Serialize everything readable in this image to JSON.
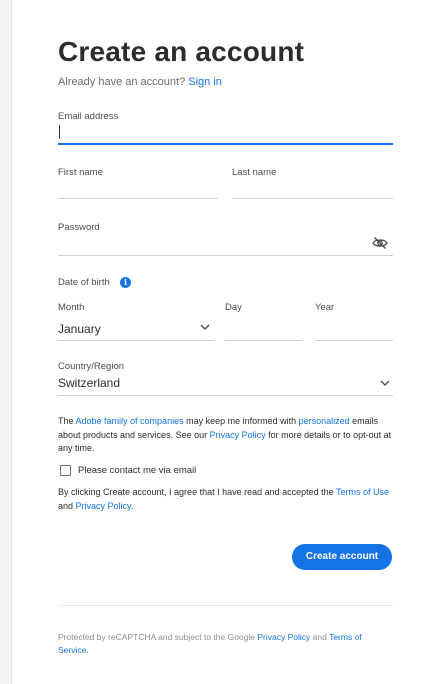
{
  "header": {
    "title": "Create an account",
    "signin_prompt": "Already have an account?",
    "signin_link": "Sign in"
  },
  "fields": {
    "email_label": "Email address",
    "email_value": "",
    "first_name_label": "First name",
    "first_name_value": "",
    "last_name_label": "Last name",
    "last_name_value": "",
    "password_label": "Password",
    "password_value": "",
    "password_toggle_icon": "eye-slash-icon"
  },
  "dob": {
    "label": "Date of birth",
    "info_icon": "info-icon",
    "month_label": "Month",
    "month_value": "January",
    "day_label": "Day",
    "day_value": "",
    "year_label": "Year",
    "year_value": ""
  },
  "country": {
    "label": "Country/Region",
    "value": "Switzerland"
  },
  "consent": {
    "text_1": "The ",
    "link_family": "Adobe family of companies",
    "text_2": " may keep me informed with ",
    "link_personalized": "personalized",
    "text_3": " emails about products and services. See our ",
    "link_privacy": "Privacy Policy",
    "text_4": " for more details or to opt-out at any time.",
    "checkbox_label": "Please contact me via email",
    "checkbox_checked": false,
    "agree_text_1": "By clicking Create account, I agree that I have read and accepted the ",
    "agree_link_terms": "Terms of Use",
    "agree_text_2": " and ",
    "agree_link_privacy": "Privacy Policy",
    "agree_text_3": "."
  },
  "actions": {
    "create_button": "Create account"
  },
  "footer": {
    "text_1": "Protected by reCAPTCHA and subject to the Google ",
    "link_privacy": "Privacy Policy",
    "text_2": " and ",
    "link_terms": "Terms of Service",
    "text_3": "."
  },
  "colors": {
    "accent": "#1473e6",
    "text": "#2c2c2c",
    "muted": "#6e6e6e"
  }
}
